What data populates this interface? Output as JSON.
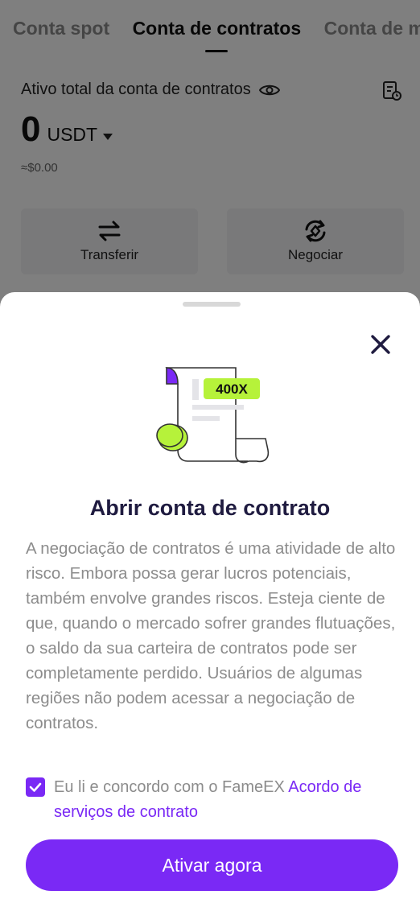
{
  "tabs": [
    {
      "label": "Conta spot",
      "active": false
    },
    {
      "label": "Conta de contratos",
      "active": true
    },
    {
      "label": "Conta de m",
      "active": false
    }
  ],
  "account": {
    "asset_label": "Ativo total da conta de contratos",
    "balance": "0",
    "currency": "USDT",
    "approx": "≈$0.00"
  },
  "actions": {
    "transfer_label": "Transferir",
    "trade_label": "Negociar"
  },
  "sheet": {
    "badge": "400X",
    "title": "Abrir conta de contrato",
    "description": "A negociação de contratos é uma atividade de alto risco. Embora possa gerar lucros potenciais, também envolve grandes riscos. Esteja ciente de que, quando o mercado sofrer grandes flutuações, o saldo da sua carteira de contratos pode ser completamente perdido. Usuários de algumas regiões não podem acessar a negociação de contratos.",
    "agree_text": "Eu li e concordo com o FameEX ",
    "agree_link": "Acordo de serviços de contrato",
    "agree_checked": true,
    "activate_label": "Ativar agora"
  },
  "colors": {
    "accent": "#7a29f5",
    "badge_green": "#b6f23a",
    "title": "#1f1b40"
  }
}
